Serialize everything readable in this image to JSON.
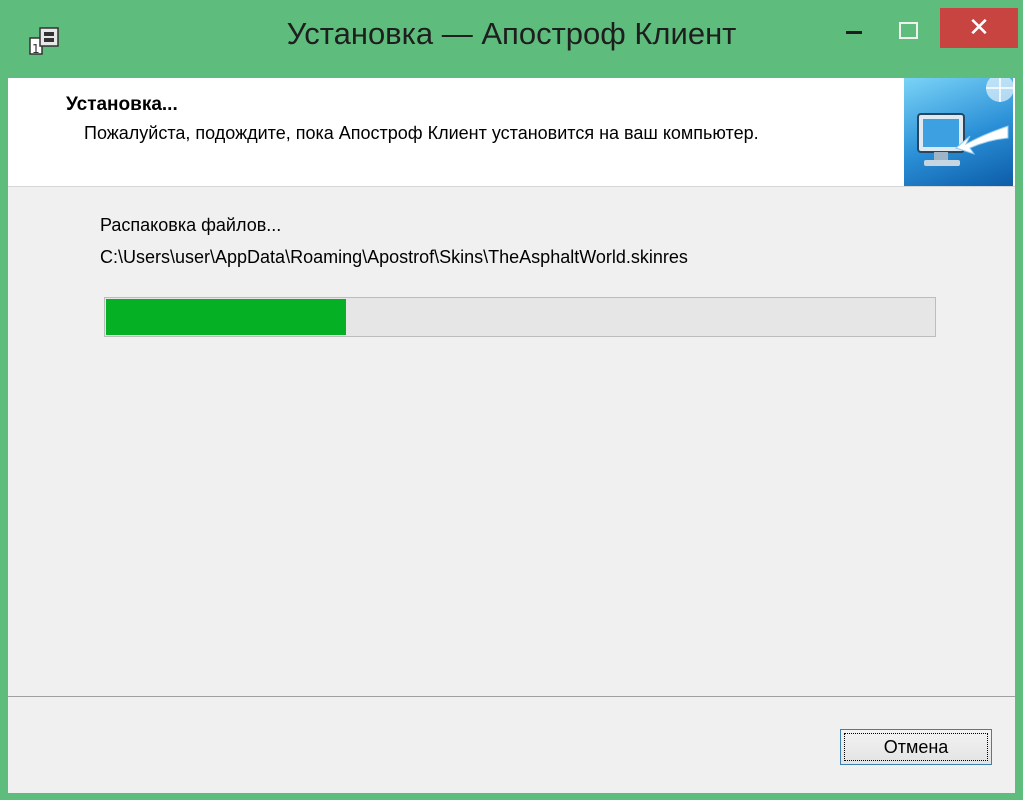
{
  "window": {
    "title": "Установка — Апостроф Клиент",
    "controls": {
      "minimize": "minimize-icon",
      "maximize": "maximize-icon",
      "close_label": "✕"
    }
  },
  "header": {
    "title": "Установка...",
    "description": "Пожалуйста, подождите, пока Апостроф Клиент установится на ваш компьютер.",
    "image_icon": "monitor-install-icon"
  },
  "main": {
    "status": "Распаковка файлов...",
    "current_file": "C:\\Users\\user\\AppData\\Roaming\\Apostrof\\Skins\\TheAsphaltWorld.skinres",
    "progress_fraction": 0.29
  },
  "footer": {
    "cancel_label": "Отмена"
  },
  "colors": {
    "titlebar": "#5ebd7c",
    "close_button": "#c84440",
    "progress_fill": "#06b025",
    "body_bg": "#f0f0f0"
  }
}
